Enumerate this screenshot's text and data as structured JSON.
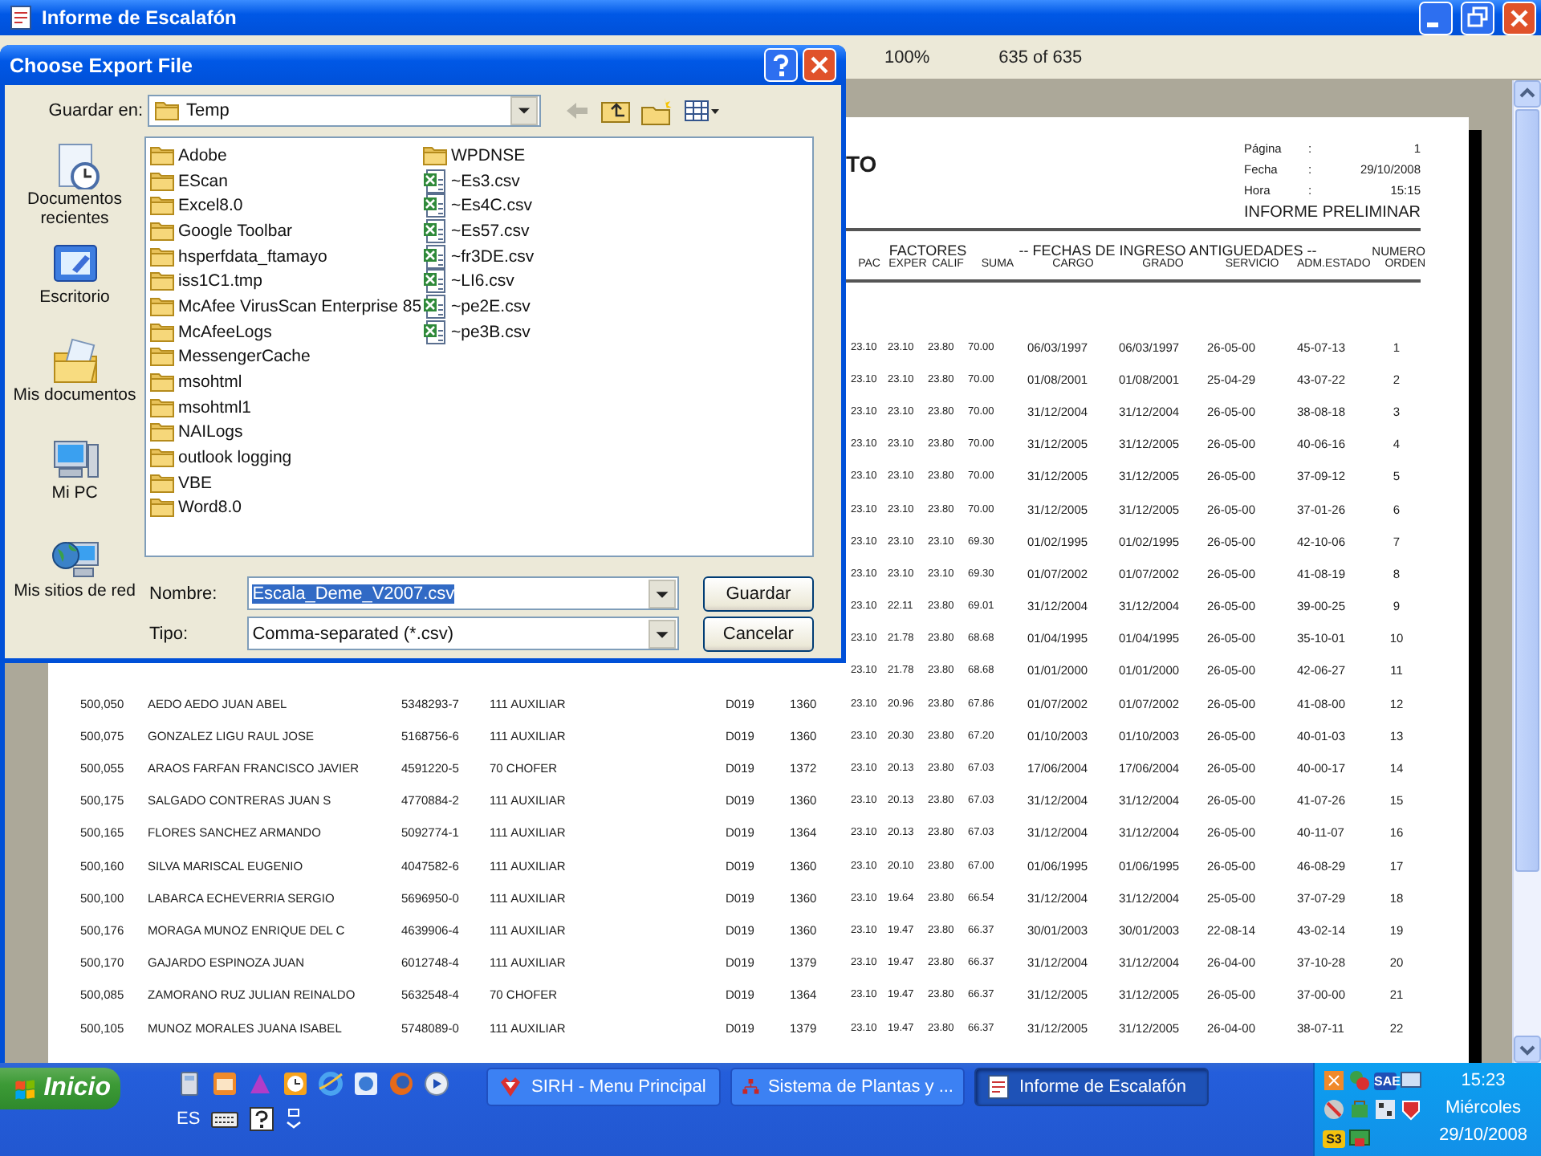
{
  "window": {
    "title": "Informe de Escalafón"
  },
  "toolbar": {
    "zoom": "100%",
    "pages": "635 of 635"
  },
  "report": {
    "title": "TO",
    "meta": [
      {
        "label": "Página",
        "separator": ":",
        "value": "1"
      },
      {
        "label": "Fecha",
        "separator": ":",
        "value": "29/10/2008"
      },
      {
        "label": "Hora",
        "separator": ":",
        "value": "15:15"
      }
    ],
    "subtitle": "INFORME PRELIMINAR",
    "group_headers": [
      "FACTORES",
      "-- FECHAS DE INGRESO ANTIGUEDADES --",
      "NUMERO"
    ],
    "columns": [
      "PAC",
      "EXPER",
      "CALIF",
      "SUMA",
      "CARGO",
      "GRADO",
      "SERVICIO",
      "ADM.ESTADO",
      "ORDEN"
    ],
    "rows": [
      {
        "cells": [
          "23.10",
          "23.10",
          "23.80",
          "70.00",
          "06/03/1997",
          "06/03/1997",
          "26-05-00",
          "45-07-13",
          "1"
        ]
      },
      {
        "cells": [
          "23.10",
          "23.10",
          "23.80",
          "70.00",
          "01/08/2001",
          "01/08/2001",
          "25-04-29",
          "43-07-22",
          "2"
        ]
      },
      {
        "cells": [
          "23.10",
          "23.10",
          "23.80",
          "70.00",
          "31/12/2004",
          "31/12/2004",
          "26-05-00",
          "38-08-18",
          "3"
        ]
      },
      {
        "cells": [
          "23.10",
          "23.10",
          "23.80",
          "70.00",
          "31/12/2005",
          "31/12/2005",
          "26-05-00",
          "40-06-16",
          "4"
        ]
      },
      {
        "cells": [
          "23.10",
          "23.10",
          "23.80",
          "70.00",
          "31/12/2005",
          "31/12/2005",
          "26-05-00",
          "37-09-12",
          "5"
        ]
      },
      {
        "cells": [
          "23.10",
          "23.10",
          "23.80",
          "70.00",
          "31/12/2005",
          "31/12/2005",
          "26-05-00",
          "37-01-26",
          "6"
        ]
      },
      {
        "cells": [
          "23.10",
          "23.10",
          "23.10",
          "69.30",
          "01/02/1995",
          "01/02/1995",
          "26-05-00",
          "42-10-06",
          "7"
        ]
      },
      {
        "cells": [
          "23.10",
          "23.10",
          "23.10",
          "69.30",
          "01/07/2002",
          "01/07/2002",
          "26-05-00",
          "41-08-19",
          "8"
        ]
      },
      {
        "cells": [
          "23.10",
          "22.11",
          "23.80",
          "69.01",
          "31/12/2004",
          "31/12/2004",
          "26-05-00",
          "39-00-25",
          "9"
        ]
      },
      {
        "cells": [
          "23.10",
          "21.78",
          "23.80",
          "68.68",
          "01/04/1995",
          "01/04/1995",
          "26-05-00",
          "35-10-01",
          "10"
        ]
      },
      {
        "cells": [
          "23.10",
          "21.78",
          "23.80",
          "68.68",
          "01/01/2000",
          "01/01/2000",
          "26-05-00",
          "42-06-27",
          "11"
        ]
      },
      {
        "cells": [
          "500,050",
          "AEDO AEDO JUAN ABEL",
          "5348293-7",
          "111 AUXILIAR",
          "D019",
          "1360",
          "23.10",
          "20.96",
          "23.80",
          "67.86",
          "01/07/2002",
          "01/07/2002",
          "26-05-00",
          "41-08-00",
          "12"
        ]
      },
      {
        "cells": [
          "500,075",
          "GONZALEZ LIGU RAUL JOSE",
          "5168756-6",
          "111 AUXILIAR",
          "D019",
          "1360",
          "23.10",
          "20.30",
          "23.80",
          "67.20",
          "01/10/2003",
          "01/10/2003",
          "26-05-00",
          "40-01-03",
          "13"
        ]
      },
      {
        "cells": [
          "500,055",
          "ARAOS FARFAN FRANCISCO JAVIER",
          "4591220-5",
          "70 CHOFER",
          "D019",
          "1372",
          "23.10",
          "20.13",
          "23.80",
          "67.03",
          "17/06/2004",
          "17/06/2004",
          "26-05-00",
          "40-00-17",
          "14"
        ]
      },
      {
        "cells": [
          "500,175",
          "SALGADO CONTRERAS JUAN S",
          "4770884-2",
          "111 AUXILIAR",
          "D019",
          "1360",
          "23.10",
          "20.13",
          "23.80",
          "67.03",
          "31/12/2004",
          "31/12/2004",
          "26-05-00",
          "41-07-26",
          "15"
        ]
      },
      {
        "cells": [
          "500,165",
          "FLORES SANCHEZ ARMANDO",
          "5092774-1",
          "111 AUXILIAR",
          "D019",
          "1364",
          "23.10",
          "20.13",
          "23.80",
          "67.03",
          "31/12/2004",
          "31/12/2004",
          "26-05-00",
          "40-11-07",
          "16"
        ]
      },
      {
        "cells": [
          "500,160",
          "SILVA MARISCAL EUGENIO",
          "4047582-6",
          "111 AUXILIAR",
          "D019",
          "1360",
          "23.10",
          "20.10",
          "23.80",
          "67.00",
          "01/06/1995",
          "01/06/1995",
          "26-05-00",
          "46-08-29",
          "17"
        ]
      },
      {
        "cells": [
          "500,100",
          "LABARCA ECHEVERRIA SERGIO",
          "5696950-0",
          "111 AUXILIAR",
          "D019",
          "1360",
          "23.10",
          "19.64",
          "23.80",
          "66.54",
          "31/12/2004",
          "31/12/2004",
          "25-05-00",
          "37-07-29",
          "18"
        ]
      },
      {
        "cells": [
          "500,176",
          "MORAGA MUNOZ ENRIQUE DEL C",
          "4639906-4",
          "111 AUXILIAR",
          "D019",
          "1360",
          "23.10",
          "19.47",
          "23.80",
          "66.37",
          "30/01/2003",
          "30/01/2003",
          "22-08-14",
          "43-02-14",
          "19"
        ]
      },
      {
        "cells": [
          "500,170",
          "GAJARDO ESPINOZA JUAN",
          "6012748-4",
          "111 AUXILIAR",
          "D019",
          "1379",
          "23.10",
          "19.47",
          "23.80",
          "66.37",
          "31/12/2004",
          "31/12/2004",
          "26-04-00",
          "37-10-28",
          "20"
        ]
      },
      {
        "cells": [
          "500,085",
          "ZAMORANO RUZ JULIAN REINALDO",
          "5632548-4",
          "70 CHOFER",
          "D019",
          "1364",
          "23.10",
          "19.47",
          "23.80",
          "66.37",
          "31/12/2005",
          "31/12/2005",
          "26-05-00",
          "37-00-00",
          "21"
        ]
      },
      {
        "cells": [
          "500,105",
          "MUNOZ MORALES JUANA ISABEL",
          "5748089-0",
          "111 AUXILIAR",
          "D019",
          "1379",
          "23.10",
          "19.47",
          "23.80",
          "66.37",
          "31/12/2005",
          "31/12/2005",
          "26-04-00",
          "38-07-11",
          "22"
        ]
      }
    ]
  },
  "dialog": {
    "title": "Choose Export File",
    "save_in_label": "Guardar en:",
    "save_in": "Temp",
    "places": [
      {
        "kind": "recent",
        "label": "Documentos recientes"
      },
      {
        "kind": "desktop",
        "label": "Escritorio"
      },
      {
        "kind": "documents",
        "label": "Mis documentos"
      },
      {
        "kind": "computer",
        "label": "Mi PC"
      },
      {
        "kind": "network",
        "label": "Mis sitios de red"
      }
    ],
    "files": [
      {
        "kind": "folder",
        "name": "Adobe"
      },
      {
        "kind": "folder",
        "name": "EScan"
      },
      {
        "kind": "folder",
        "name": "Excel8.0"
      },
      {
        "kind": "folder",
        "name": "Google Toolbar"
      },
      {
        "kind": "folder",
        "name": "hsperfdata_ftamayo"
      },
      {
        "kind": "folder",
        "name": "iss1C1.tmp"
      },
      {
        "kind": "folder",
        "name": "McAfee VirusScan Enterprise 85"
      },
      {
        "kind": "folder",
        "name": "McAfeeLogs"
      },
      {
        "kind": "folder",
        "name": "MessengerCache"
      },
      {
        "kind": "folder",
        "name": "msohtml"
      },
      {
        "kind": "folder",
        "name": "msohtml1"
      },
      {
        "kind": "folder",
        "name": "NAILogs"
      },
      {
        "kind": "folder",
        "name": "outlook logging"
      },
      {
        "kind": "folder",
        "name": "VBE"
      },
      {
        "kind": "folder",
        "name": "Word8.0"
      },
      {
        "kind": "folder",
        "name": "WPDNSE"
      },
      {
        "kind": "csv",
        "name": "~Es3.csv"
      },
      {
        "kind": "csv",
        "name": "~Es4C.csv"
      },
      {
        "kind": "csv",
        "name": "~Es57.csv"
      },
      {
        "kind": "csv",
        "name": "~fr3DE.csv"
      },
      {
        "kind": "csv",
        "name": "~LI6.csv"
      },
      {
        "kind": "csv",
        "name": "~pe2E.csv"
      },
      {
        "kind": "csv",
        "name": "~pe3B.csv"
      }
    ],
    "filename_label": "Nombre:",
    "filename": {
      "value": "Escala_Deme_V2007.csv",
      "highlighted": true
    },
    "type_label": "Tipo:",
    "type": "Comma-separated (*.csv)",
    "buttons": [
      "Guardar",
      "Cancelar"
    ]
  },
  "taskbar": {
    "start": "Inicio",
    "language": "ES",
    "tasks": [
      {
        "label": "SIRH - Menu Principal",
        "selected": false
      },
      {
        "label": "Sistema de Plantas y ...",
        "selected": false
      },
      {
        "label": "Informe de Escalafón",
        "selected": true
      }
    ],
    "tray_labels": [
      "SAE",
      "S3"
    ],
    "clock": {
      "time": "15:23",
      "day": "Miércoles",
      "date": "29/10/2008"
    }
  }
}
